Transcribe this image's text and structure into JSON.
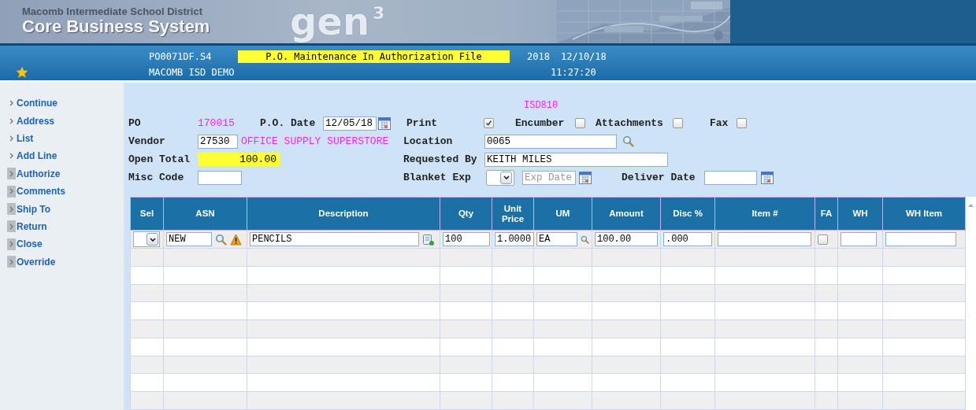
{
  "banner": {
    "org": "Macomb Intermediate School District",
    "system": "Core Business System",
    "logo": "gen",
    "logo_sup": "3"
  },
  "infobar": {
    "program": "PO0071DF.S4",
    "title": "P.O. Maintenance In Authorization File",
    "year": "2018",
    "date": "12/10/18",
    "company": "MACOMB ISD DEMO",
    "time": "11:27:20"
  },
  "sidebar": {
    "items": [
      {
        "label": "Continue",
        "marked": false
      },
      {
        "label": "Address",
        "marked": false
      },
      {
        "label": "List",
        "marked": false
      },
      {
        "label": "Add Line",
        "marked": false
      },
      {
        "label": "Authorize",
        "marked": true
      },
      {
        "label": "Comments",
        "marked": true
      },
      {
        "label": "Ship To",
        "marked": true
      },
      {
        "label": "Return",
        "marked": true
      },
      {
        "label": "Close",
        "marked": true
      },
      {
        "label": "Override",
        "marked": true
      }
    ]
  },
  "form": {
    "user": "ISD810",
    "po": {
      "label": "PO",
      "value": "170015"
    },
    "po_date": {
      "label": "P.O. Date",
      "value": "12/05/18"
    },
    "print": {
      "label": "Print",
      "checked": true
    },
    "encumber": {
      "label": "Encumber",
      "checked": false
    },
    "attachments": {
      "label": "Attachments",
      "checked": false
    },
    "fax": {
      "label": "Fax",
      "checked": false
    },
    "vendor": {
      "label": "Vendor",
      "value": "27530",
      "name": "OFFICE SUPPLY SUPERSTORE"
    },
    "location": {
      "label": "Location",
      "value": "0065"
    },
    "open_total": {
      "label": "Open Total",
      "value": "100.00"
    },
    "requested_by": {
      "label": "Requested By",
      "value": "KEITH MILES"
    },
    "misc_code": {
      "label": "Misc Code"
    },
    "blanket_exp": {
      "label": "Blanket Exp",
      "placeholder": "Exp Date"
    },
    "deliver_date": {
      "label": "Deliver Date"
    }
  },
  "table": {
    "columns": [
      "Sel",
      "ASN",
      "Description",
      "Qty",
      "Unit Price",
      "UM",
      "Amount",
      "Disc %",
      "Item #",
      "FA",
      "WH",
      "WH Item"
    ],
    "rows": [
      {
        "asn": "NEW",
        "description": "PENCILS",
        "qty": "100",
        "unit_price": "1.0000",
        "um": "EA",
        "amount": "100.00",
        "disc": ".000",
        "fa": false
      }
    ]
  }
}
